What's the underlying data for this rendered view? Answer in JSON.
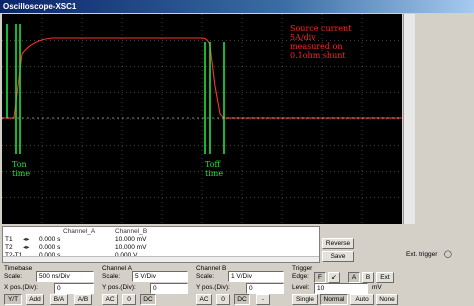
{
  "window": {
    "title": "Oscilloscope-XSC1"
  },
  "annotations": {
    "source_lines": [
      "Source current",
      "5A/div",
      "measured on",
      "0.1ohm shunt"
    ],
    "ton_lines": [
      "Ton",
      "time"
    ],
    "toff_lines": [
      "Toff",
      "time"
    ]
  },
  "colors": {
    "trace_a": "#22e040",
    "trace_b": "#ff3030",
    "screen": "#000000",
    "grid": "#808080"
  },
  "measurements": {
    "headers": {
      "channel_a": "Channel_A",
      "channel_b": "Channel_B"
    },
    "rows": [
      {
        "label": "T1",
        "time": "0.000 s",
        "channel_a": "",
        "channel_b": "10.000 mV"
      },
      {
        "label": "T2",
        "time": "0.000 s",
        "channel_a": "",
        "channel_b": "10.000 mV"
      },
      {
        "label": "T2-T1",
        "time": "0.000 s",
        "channel_a": "",
        "channel_b": "0.000 V"
      }
    ]
  },
  "buttons": {
    "reverse": "Reverse",
    "save": "Save",
    "ext_trigger": "Ext. trigger"
  },
  "timebase": {
    "title": "Timebase",
    "scale_label": "Scale:",
    "scale": "500 ns/Div",
    "xpos_label": "X pos.(Div):",
    "xpos": "0",
    "modes": [
      "Y/T",
      "Add",
      "B/A",
      "A/B"
    ]
  },
  "channel_a": {
    "title": "Channel A",
    "scale_label": "Scale:",
    "scale": "5 V/Div",
    "ypos_label": "Y pos.(Div):",
    "ypos": "0",
    "coupling": [
      "AC",
      "0",
      "DC"
    ]
  },
  "channel_b": {
    "title": "Channel B",
    "scale_label": "Scale:",
    "scale": "1 V/Div",
    "ypos_label": "Y pos.(Div):",
    "ypos": "0",
    "coupling": [
      "AC",
      "0",
      "DC",
      "-"
    ]
  },
  "trigger": {
    "title": "Trigger",
    "edge_label": "Edge:",
    "edges": [
      "F",
      "↙",
      "A",
      "B",
      "Ext"
    ],
    "level_label": "Level:",
    "level": "10",
    "level_unit": "mV",
    "modes": [
      "Single",
      "Normal",
      "Auto",
      "None"
    ]
  }
}
